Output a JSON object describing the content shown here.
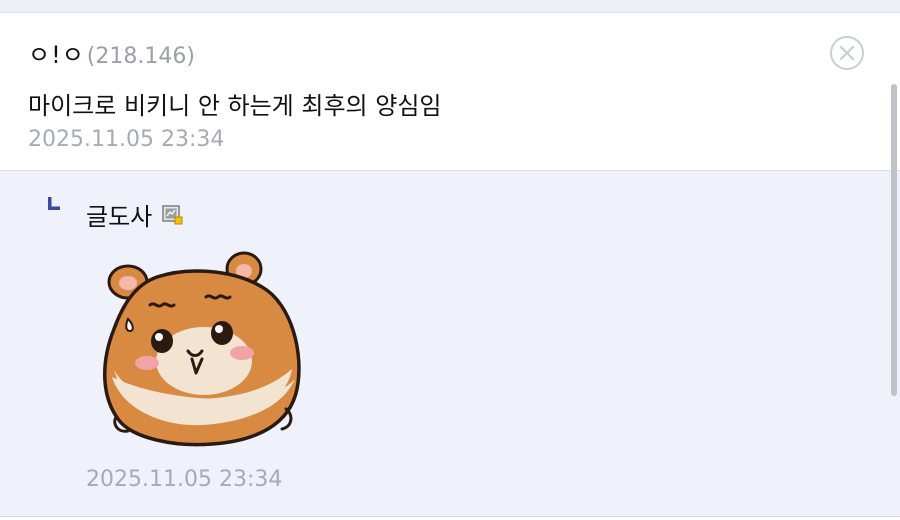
{
  "comment": {
    "nickname": "ㅇ!ㅇ",
    "ip": "(218.146)",
    "text": "마이크로 비키니 안 하는게 최후의 양심임",
    "timestamp": "2025.11.05 23:34",
    "delete_icon": "close-circle-icon"
  },
  "reply": {
    "marker_icon": "reply-arrow-icon",
    "nickname": "글도사",
    "gallog_icon": "gallog-icon",
    "sticker": "hamster-sticker",
    "timestamp": "2025.11.05 23:34"
  },
  "colors": {
    "reply_background": "#eff1fb",
    "reply_marker": "#3b4a9a",
    "timestamp": "#a6abb3",
    "ip": "#9aa0a8"
  }
}
